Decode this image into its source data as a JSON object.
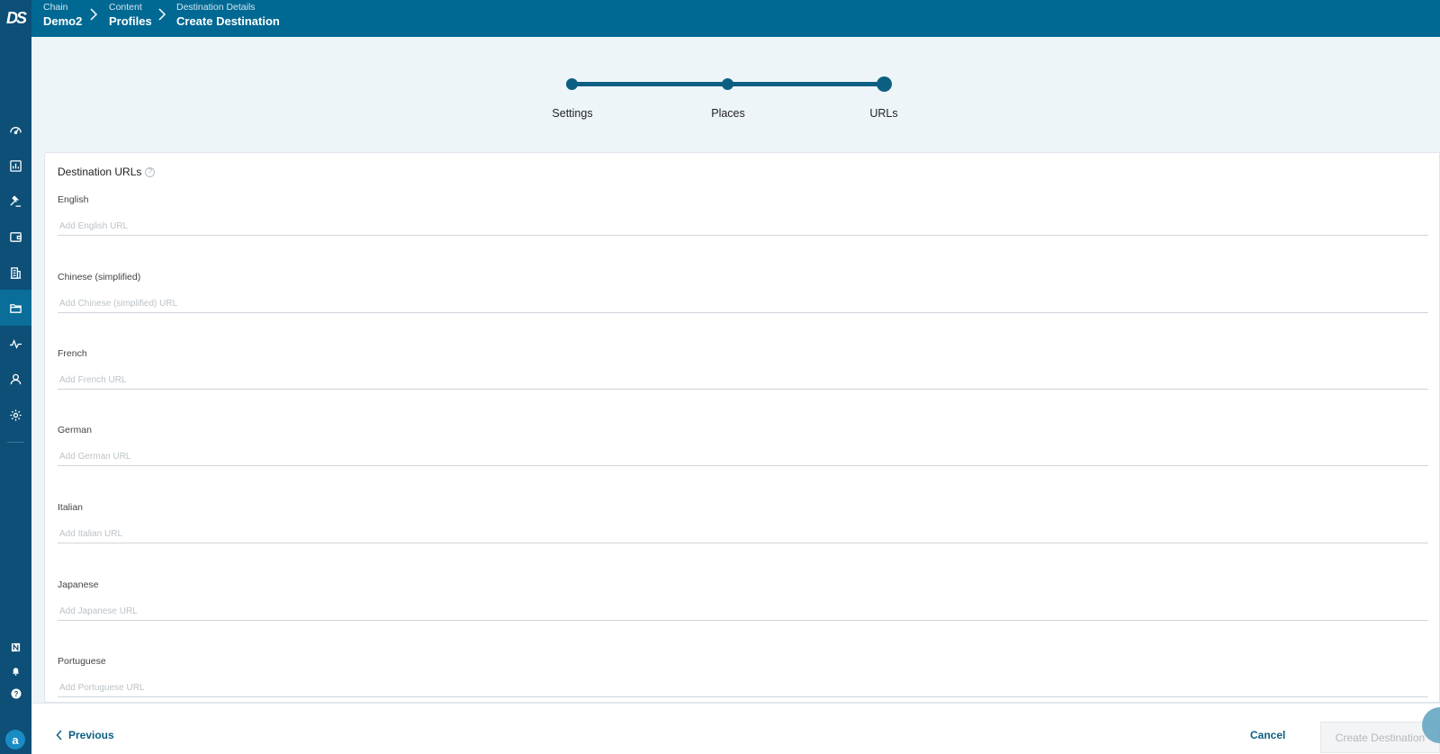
{
  "app": {
    "logo_text": "DS"
  },
  "breadcrumb": [
    {
      "small": "Chain",
      "big": "Demo2"
    },
    {
      "small": "Content",
      "big": "Profiles"
    },
    {
      "small": "Destination Details",
      "big": "Create Destination"
    }
  ],
  "sidebar": {
    "items": [
      {
        "icon": "dashboard-gauge-icon",
        "active": false
      },
      {
        "icon": "analytics-chart-icon",
        "active": false
      },
      {
        "icon": "gavel-icon",
        "active": false
      },
      {
        "icon": "wallet-icon",
        "active": false
      },
      {
        "icon": "building-icon",
        "active": false
      },
      {
        "icon": "folder-icon",
        "active": true
      },
      {
        "icon": "pulse-activity-icon",
        "active": false
      },
      {
        "icon": "user-icon",
        "active": false
      },
      {
        "icon": "settings-gear-icon",
        "active": false
      }
    ],
    "bottom": [
      "news-icon",
      "bell-icon",
      "help-icon"
    ],
    "avatar_letter": "a"
  },
  "stepper": {
    "steps": [
      "Settings",
      "Places",
      "URLs"
    ],
    "current": 2
  },
  "form": {
    "title": "Destination URLs",
    "fields": [
      {
        "label": "English",
        "placeholder": "Add English URL",
        "value": ""
      },
      {
        "label": "Chinese (simplified)",
        "placeholder": "Add Chinese (simplified) URL",
        "value": ""
      },
      {
        "label": "French",
        "placeholder": "Add French URL",
        "value": ""
      },
      {
        "label": "German",
        "placeholder": "Add German URL",
        "value": ""
      },
      {
        "label": "Italian",
        "placeholder": "Add Italian URL",
        "value": ""
      },
      {
        "label": "Japanese",
        "placeholder": "Add Japanese URL",
        "value": ""
      },
      {
        "label": "Portuguese",
        "placeholder": "Add Portuguese URL",
        "value": ""
      }
    ]
  },
  "footer": {
    "previous_label": "Previous",
    "cancel_label": "Cancel",
    "create_label": "Create Destination"
  },
  "colors": {
    "sidebar": "#0d4f77",
    "header": "#006993",
    "accent": "#0d5f82",
    "page_bg": "#eef5f9"
  }
}
